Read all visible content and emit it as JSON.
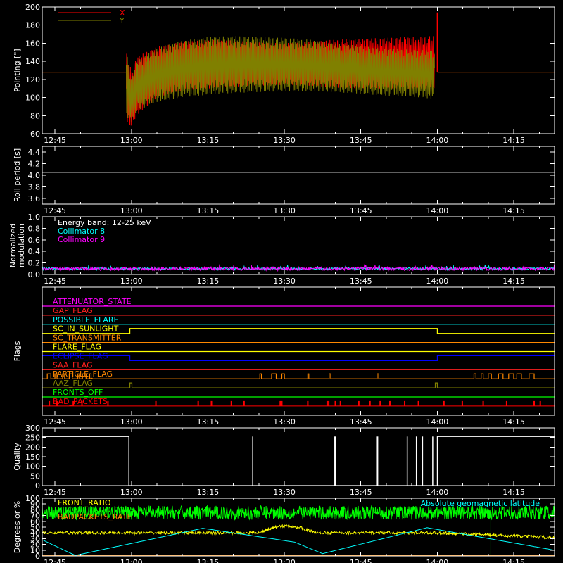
{
  "time_axis": {
    "tick_labels": [
      "12:45",
      "13:00",
      "13:15",
      "13:30",
      "13:45",
      "14:00",
      "14:15"
    ],
    "tick_minutes": [
      -15,
      0,
      15,
      30,
      45,
      60,
      75
    ],
    "range_minutes": [
      -17.5,
      83
    ]
  },
  "chart_data": [
    {
      "id": "pointing",
      "type": "line",
      "ylabel": "Pointing [\"]",
      "ylim": [
        60,
        200
      ],
      "yticks": [
        60,
        80,
        100,
        120,
        140,
        160,
        180,
        200
      ],
      "legend": "top-left",
      "series": [
        {
          "name": "X",
          "color": "#ff0000",
          "baseline": 128,
          "envelope_upper": [
            [
              -1,
              150
            ],
            [
              0,
              130
            ],
            [
              1,
              145
            ],
            [
              5,
              156
            ],
            [
              10,
              162
            ],
            [
              15,
              164
            ],
            [
              20,
              163
            ],
            [
              25,
              161
            ],
            [
              30,
              160
            ],
            [
              35,
              162
            ],
            [
              40,
              164
            ],
            [
              45,
              165
            ],
            [
              50,
              166
            ],
            [
              55,
              167
            ],
            [
              59.5,
              168
            ]
          ],
          "envelope_lower": [
            [
              -1,
              70
            ],
            [
              0,
              68
            ],
            [
              1,
              80
            ],
            [
              5,
              100
            ],
            [
              10,
              108
            ],
            [
              15,
              110
            ],
            [
              20,
              112
            ],
            [
              25,
              113
            ],
            [
              30,
              114
            ],
            [
              35,
              113
            ],
            [
              40,
              111
            ],
            [
              45,
              110
            ],
            [
              50,
              110
            ],
            [
              55,
              110
            ],
            [
              59.5,
              110
            ]
          ],
          "spike_at": 60,
          "spike_value": 194
        },
        {
          "name": "Y",
          "color": "#808000",
          "baseline": 128,
          "envelope_upper": [
            [
              -1,
              152
            ],
            [
              0,
              120
            ],
            [
              1,
              140
            ],
            [
              5,
              155
            ],
            [
              10,
              163
            ],
            [
              15,
              167
            ],
            [
              20,
              168
            ],
            [
              25,
              167
            ],
            [
              30,
              166
            ],
            [
              35,
              164
            ],
            [
              40,
              160
            ],
            [
              45,
              157
            ],
            [
              50,
              154
            ],
            [
              55,
              153
            ],
            [
              59.5,
              152
            ]
          ],
          "envelope_lower": [
            [
              -1,
              80
            ],
            [
              0,
              72
            ],
            [
              1,
              85
            ],
            [
              5,
              95
            ],
            [
              10,
              100
            ],
            [
              15,
              103
            ],
            [
              20,
              105
            ],
            [
              25,
              106
            ],
            [
              30,
              107
            ],
            [
              35,
              107
            ],
            [
              40,
              106
            ],
            [
              45,
              104
            ],
            [
              50,
              102
            ],
            [
              55,
              101
            ],
            [
              59.5,
              98
            ]
          ]
        }
      ]
    },
    {
      "id": "roll",
      "type": "line",
      "ylabel": "Roll period [s]",
      "ylim": [
        3.5,
        4.5
      ],
      "yticks": [
        3.6,
        3.8,
        4.0,
        4.2,
        4.4
      ],
      "series": [
        {
          "color": "#ffffff",
          "constant": 4.05
        }
      ]
    },
    {
      "id": "modulation",
      "type": "line",
      "ylabel": [
        "Normalized",
        "modulation"
      ],
      "ylim": [
        0,
        1
      ],
      "yticks": [
        0.0,
        0.2,
        0.4,
        0.6,
        0.8,
        1.0
      ],
      "annotation": "Energy band: 12-25 keV",
      "series": [
        {
          "name": "Collimator 8",
          "color": "#00ffff",
          "mean": 0.1
        },
        {
          "name": "Collimator 9",
          "color": "#ff00ff",
          "mean": 0.1,
          "noise": 0.03
        }
      ]
    },
    {
      "id": "flags",
      "type": "line",
      "ylabel": "Flags",
      "rows": [
        {
          "name": "ATTENUATOR_STATE",
          "color": "#ff00ff",
          "high": []
        },
        {
          "name": "GAP_FLAG",
          "color": "#ff2020",
          "high": []
        },
        {
          "name": "POSSIBLE_FLARE",
          "color": "#00ffff",
          "high": []
        },
        {
          "name": "SC_IN_SUNLIGHT",
          "color": "#ffff00",
          "high": [
            [
              -0.3,
              60
            ]
          ]
        },
        {
          "name": "SC_TRANSMITTER",
          "color": "#ff8800",
          "high": []
        },
        {
          "name": "FLARE_FLAG",
          "color": "#ffff00",
          "high": []
        },
        {
          "name": "ECLIPSE_FLAG",
          "color": "#0000ff",
          "high": [
            [
              -17.5,
              -0.3
            ],
            [
              60,
              83
            ]
          ]
        },
        {
          "name": "SAA_FLAG",
          "color": "#ff2020",
          "high": []
        },
        {
          "name": "PARTICLE_FLAG",
          "color": "#ff8800",
          "high": [
            [
              -16.5,
              -15.8
            ],
            [
              -15,
              -14.6
            ],
            [
              -13.5,
              -13.1
            ],
            [
              -12.2,
              -11.6
            ],
            [
              -10.5,
              -10.2
            ],
            [
              -9.6,
              -8.9
            ],
            [
              -8.2,
              -7.9
            ],
            [
              25.2,
              25.5
            ],
            [
              27.5,
              28.4
            ],
            [
              29.5,
              30
            ],
            [
              34.6,
              34.8
            ],
            [
              38.8,
              39.1
            ],
            [
              48.2,
              48.5
            ],
            [
              67.2,
              67.6
            ],
            [
              68.6,
              69
            ],
            [
              70,
              70.6
            ],
            [
              72,
              72.9
            ],
            [
              74,
              75
            ],
            [
              75.6,
              76.5
            ],
            [
              78,
              79
            ]
          ]
        },
        {
          "name": "AAZ_FLAG",
          "color": "#808000",
          "high": [
            [
              -0.3,
              0.1
            ],
            [
              59.6,
              60
            ]
          ]
        },
        {
          "name": "FRONTS_OFF",
          "color": "#00ff00",
          "high": []
        },
        {
          "name": "BAD_PACKETS",
          "color": "#ff0000",
          "spikes": [
            -16.1,
            -14.6,
            -11.4,
            -9.7,
            -4.6,
            4.8,
            13.1,
            15.7,
            19.6,
            22.1,
            29.2,
            29.5,
            34.6,
            38.4,
            38.7,
            40,
            41,
            44.6,
            46.8,
            48.8,
            50.7,
            53.6,
            56.3,
            61.3,
            64.9,
            69,
            73.6,
            79,
            80.2
          ]
        }
      ]
    },
    {
      "id": "quality",
      "type": "bar",
      "ylabel": "Quality",
      "ylim": [
        0,
        300
      ],
      "yticks": [
        0,
        50,
        100,
        150,
        200,
        250,
        300
      ],
      "series": [
        {
          "color": "#ffffff",
          "segments": [
            [
              -17.5,
              -0.5,
              255
            ],
            [
              -0.5,
              60,
              0
            ],
            [
              60,
              83,
              255
            ]
          ],
          "spikes": [
            23.8,
            39.9,
            40.1,
            48.1,
            48.3,
            54.1,
            55.9,
            57.1,
            59.1
          ]
        }
      ]
    },
    {
      "id": "geomag",
      "type": "line",
      "ylabel": "Degrees or %",
      "ylim": [
        0,
        100
      ],
      "yticks": [
        0,
        10,
        20,
        30,
        40,
        50,
        60,
        70,
        80,
        90,
        100
      ],
      "series": [
        {
          "name": "FRONT_RATIO",
          "color": "#ffff00",
          "mean": 40
        },
        {
          "name": "FRONT_RATIO_1225",
          "color": "#00ff00",
          "mean": 75
        },
        {
          "name": "BADPACKETS_RATE",
          "color": "#ff8800",
          "mean": 1
        },
        {
          "name": "Absolute geomagnetic latitude",
          "color": "#00ffff",
          "points": [
            [
              -17.5,
              28
            ],
            [
              -11,
              1
            ],
            [
              14,
              48
            ],
            [
              32,
              24
            ],
            [
              37.5,
              4
            ],
            [
              58,
              49
            ],
            [
              83,
              10
            ]
          ]
        }
      ]
    }
  ]
}
